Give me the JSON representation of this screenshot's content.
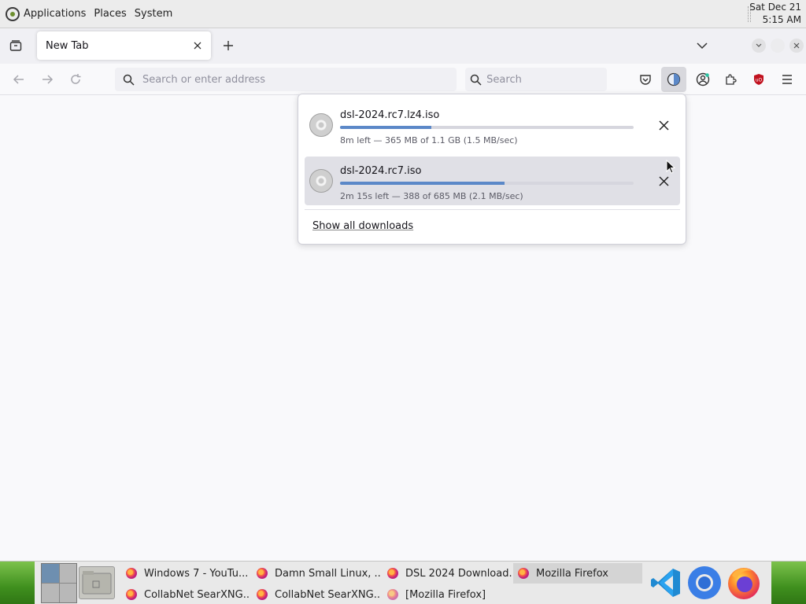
{
  "top_panel": {
    "menus": [
      "Applications",
      "Places",
      "System"
    ],
    "clock_date": "Sat Dec 21",
    "clock_time": "5:15 AM"
  },
  "browser": {
    "active_tab_title": "New Tab",
    "url_placeholder": "Search or enter address",
    "search_placeholder": "Search"
  },
  "downloads": {
    "items": [
      {
        "filename": "dsl-2024.rc7.lz4.iso",
        "status": "8m left — 365 MB of 1.1 GB (1.5 MB/sec)",
        "progress": 0.31
      },
      {
        "filename": "dsl-2024.rc7.iso",
        "status": "2m 15s left — 388 of 685 MB (2.1 MB/sec)",
        "progress": 0.56
      }
    ],
    "show_all_label": "Show all downloads"
  },
  "taskbar": {
    "tasks": [
      {
        "label": "Windows 7 - YouTu..."
      },
      {
        "label": "Damn Small Linux, ..."
      },
      {
        "label": "DSL 2024 Download..."
      },
      {
        "label": "Mozilla Firefox"
      },
      {
        "label": "CollabNet SearXNG..."
      },
      {
        "label": "CollabNet SearXNG..."
      },
      {
        "label": "[Mozilla Firefox]"
      }
    ],
    "dock_icons": [
      "vscode-icon",
      "chromium-icon",
      "firefox-icon"
    ]
  },
  "colors": {
    "progress_fill": "#5b88c8",
    "hover_row": "#e0e0e6",
    "ublock_red": "#c1121f"
  }
}
